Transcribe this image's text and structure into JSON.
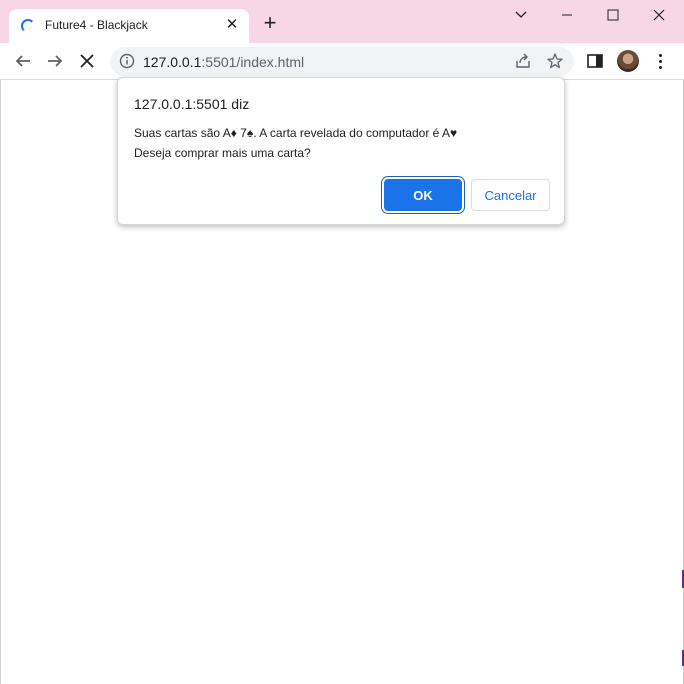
{
  "browser": {
    "tab": {
      "title": "Future4 - Blackjack",
      "loading_icon": "spinner-icon",
      "close_glyph": "✕"
    },
    "new_tab_glyph": "+",
    "address": {
      "host": "127.0.0.1",
      "rest": ":5501/index.html"
    }
  },
  "dialog": {
    "title": "127.0.0.1:5501 diz",
    "message_line1": "Suas cartas são A♦ 7♠. A carta revelada do computador é A♥",
    "message_line2": "Deseja comprar mais uma carta?",
    "ok_label": "OK",
    "cancel_label": "Cancelar"
  },
  "colors": {
    "titlebar": "#f7d6e6",
    "accent": "#1a73e8"
  }
}
